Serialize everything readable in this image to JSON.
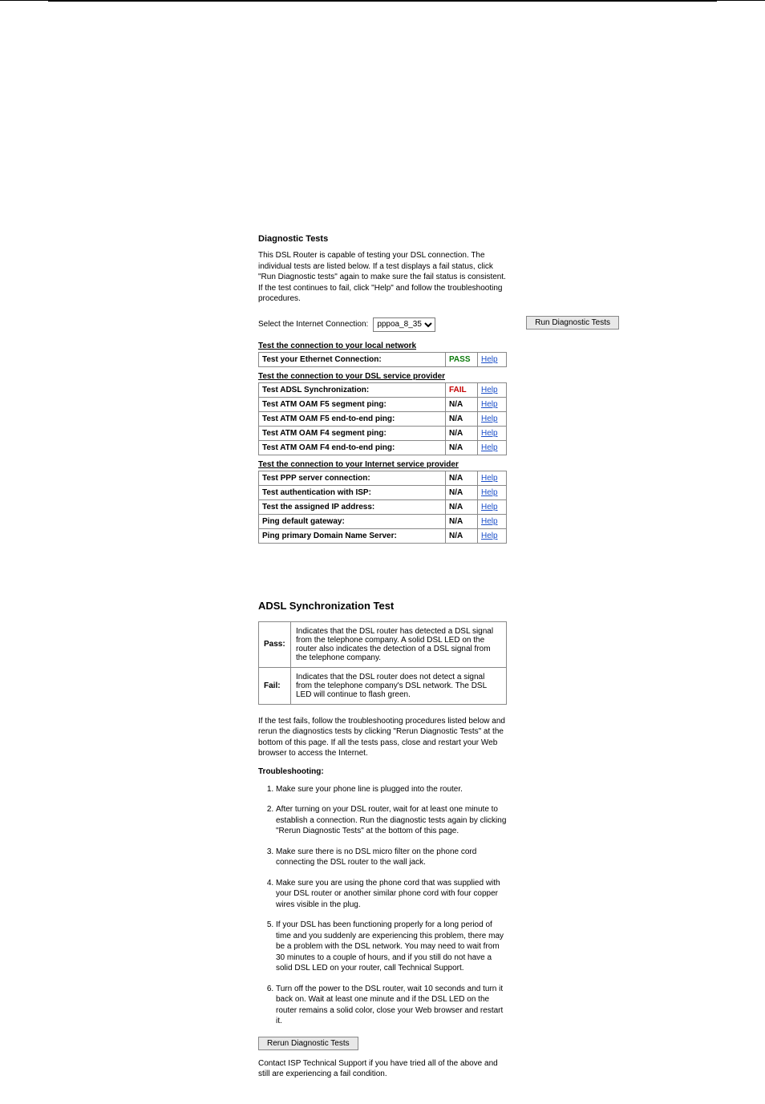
{
  "diag": {
    "title": "Diagnostic Tests",
    "desc": "This DSL Router is capable of testing your DSL connection. The individual tests are listed below. If a test displays a fail status, click \"Run Diagnostic tests\" again to make sure the fail status is consistent. If the test continues to fail, click \"Help\" and follow the troubleshooting procedures.",
    "select_label": "Select the Internet Connection:",
    "select_value": "pppoa_8_35",
    "run_btn": "Run Diagnostic Tests",
    "help_label": "Help",
    "sections": {
      "local": {
        "header": "Test the connection to your local network",
        "rows": [
          {
            "name": "Test your Ethernet Connection:",
            "status": "PASS",
            "cls": "pass"
          }
        ]
      },
      "dsl": {
        "header": "Test the connection to your DSL service provider",
        "rows": [
          {
            "name": "Test ADSL Synchronization:",
            "status": "FAIL",
            "cls": "fail"
          },
          {
            "name": "Test ATM OAM F5 segment ping:",
            "status": "N/A",
            "cls": ""
          },
          {
            "name": "Test ATM OAM F5 end-to-end ping:",
            "status": "N/A",
            "cls": ""
          },
          {
            "name": "Test ATM OAM F4 segment ping:",
            "status": "N/A",
            "cls": ""
          },
          {
            "name": "Test ATM OAM F4 end-to-end ping:",
            "status": "N/A",
            "cls": ""
          }
        ]
      },
      "isp": {
        "header": "Test the connection to your Internet service provider",
        "rows": [
          {
            "name": "Test PPP server connection:",
            "status": "N/A",
            "cls": ""
          },
          {
            "name": "Test authentication with ISP:",
            "status": "N/A",
            "cls": ""
          },
          {
            "name": "Test the assigned IP address:",
            "status": "N/A",
            "cls": ""
          },
          {
            "name": "Ping default gateway:",
            "status": "N/A",
            "cls": ""
          },
          {
            "name": "Ping primary Domain Name Server:",
            "status": "N/A",
            "cls": ""
          }
        ]
      }
    }
  },
  "help": {
    "title": "ADSL Synchronization Test",
    "pass_label": "Pass:",
    "pass_text": "Indicates that the DSL router has detected a DSL signal from the telephone company. A solid DSL LED on the router also indicates the detection of a DSL signal from the telephone company.",
    "fail_label": "Fail:",
    "fail_text": "Indicates that the DSL router does not detect a signal from the telephone company's DSL network. The DSL LED will continue to flash green.",
    "para": "If the test fails, follow the troubleshooting procedures listed below and rerun the diagnostics tests by clicking \"Rerun Diagnostic Tests\" at the bottom of this page. If all the tests pass, close and restart your Web browser to access the Internet.",
    "tshoot": "Troubleshooting:",
    "steps": [
      "Make sure your phone line is plugged into the router.",
      "After turning on your DSL router, wait for at least one minute to establish a connection. Run the diagnostic tests again by clicking \"Rerun Diagnostic Tests\" at the bottom of this page.",
      "Make sure there is no DSL micro filter on the phone cord connecting the DSL router to the wall jack.",
      "Make sure you are using the phone cord that was supplied with your DSL router or another similar phone cord with four copper wires visible in the plug.",
      "If your DSL has been functioning properly for a long period of time and you suddenly are experiencing this problem, there may be a problem with the DSL network. You may need to wait from 30 minutes to a couple of hours, and if you still do not have a solid DSL LED on your router, call Technical Support.",
      "Turn off the power to the DSL router, wait 10 seconds and turn it back on. Wait at least one minute and if the DSL LED on the router remains a solid color, close your Web browser and restart it."
    ],
    "rerun": "Rerun Diagnostic Tests",
    "contact": "Contact ISP Technical Support if you have tried all of the above and still are experiencing a fail condition."
  }
}
